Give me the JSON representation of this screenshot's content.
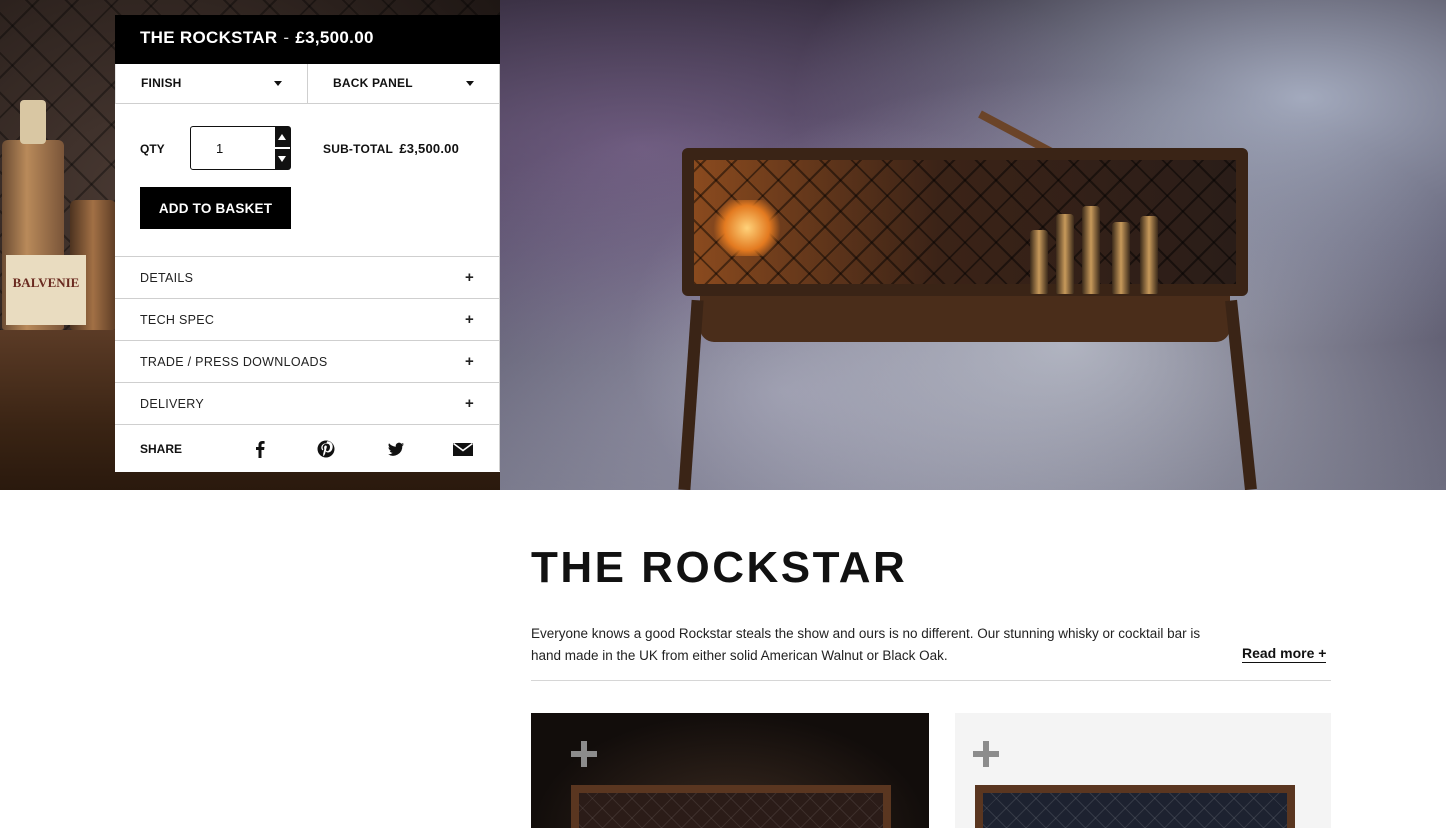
{
  "product": {
    "name": "THE ROCKSTAR",
    "separator": "-",
    "price": "£3,500.00"
  },
  "options": {
    "finish_label": "FINISH",
    "back_panel_label": "BACK PANEL"
  },
  "purchase": {
    "qty_label": "QTY",
    "qty_value": "1",
    "subtotal_label": "SUB-TOTAL",
    "subtotal_value": "£3,500.00",
    "add_to_basket": "ADD TO BASKET"
  },
  "accordion": [
    {
      "label": "DETAILS",
      "toggle": "+"
    },
    {
      "label": "TECH SPEC",
      "toggle": "+"
    },
    {
      "label": "TRADE / PRESS DOWNLOADS",
      "toggle": "+"
    },
    {
      "label": "DELIVERY",
      "toggle": "+"
    }
  ],
  "share": {
    "label": "SHARE",
    "icons": [
      "facebook-icon",
      "pinterest-icon",
      "twitter-icon",
      "email-icon"
    ]
  },
  "hero_left": {
    "label_text": "BALVENIE"
  },
  "content": {
    "title": "THE ROCKSTAR",
    "description": "Everyone knows a good Rockstar steals the show and ours is no different. Our stunning whisky or cocktail bar is hand made in the UK from either solid American Walnut or Black Oak.",
    "read_more": "Read more +"
  },
  "gallery": [
    {
      "finish": "walnut",
      "zoom_icon": "plus-zoom-icon"
    },
    {
      "finish": "black-oak",
      "zoom_icon": "plus-zoom-icon"
    }
  ],
  "colors": {
    "header_bg": "#000000",
    "button_bg": "#000000",
    "text": "#111111",
    "border": "#cfcfcf"
  }
}
